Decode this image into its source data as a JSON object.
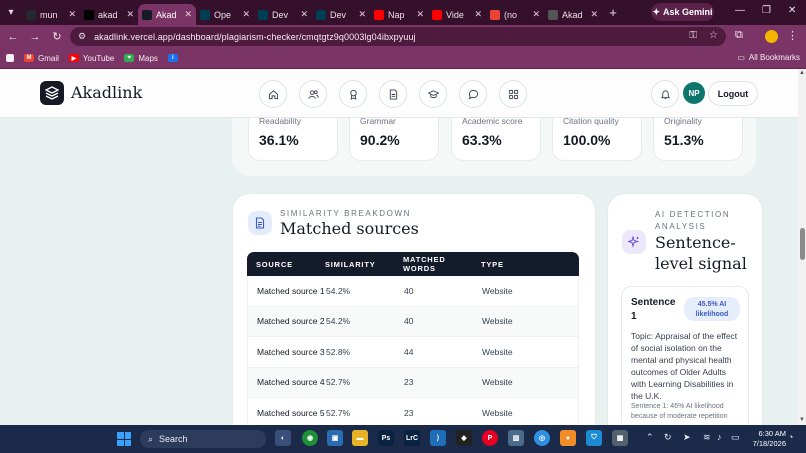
{
  "browser": {
    "tabs": [
      {
        "title": "mun",
        "active": false,
        "favicon": "github-icon",
        "color": "#24292f"
      },
      {
        "title": "akad",
        "active": false,
        "favicon": "vercel-icon",
        "color": "#000000"
      },
      {
        "title": "Akad",
        "active": true,
        "favicon": "akadlink-icon",
        "color": "#151a25"
      },
      {
        "title": "Ope",
        "active": false,
        "favicon": "devpost-icon",
        "color": "#003e54"
      },
      {
        "title": "Dev",
        "active": false,
        "favicon": "devpost-icon",
        "color": "#003e54"
      },
      {
        "title": "Dev",
        "active": false,
        "favicon": "devpost-icon",
        "color": "#003e54"
      },
      {
        "title": "Nap",
        "active": false,
        "favicon": "youtube-icon",
        "color": "#ff0000"
      },
      {
        "title": "Vide",
        "active": false,
        "favicon": "youtube-icon",
        "color": "#ff0000"
      },
      {
        "title": "(no",
        "active": false,
        "favicon": "gmail-icon",
        "color": "#ea4335"
      },
      {
        "title": "Akad",
        "active": false,
        "favicon": "akadlink-icon",
        "color": "#555555"
      }
    ],
    "gemini_label": "Ask Gemini",
    "url": "akadlink.vercel.app/dashboard/plagiarism-checker/cmqtgtz9q0003lg04ibxpyuuj",
    "bookmarks": [
      {
        "label": "Gmail",
        "icon": "gmail-icon",
        "color": "#ea4335"
      },
      {
        "label": "YouTube",
        "icon": "youtube-icon",
        "color": "#ff0000"
      },
      {
        "label": "Maps",
        "icon": "maps-icon",
        "color": "#34a853"
      }
    ],
    "all_bookmarks_label": "All Bookmarks"
  },
  "app": {
    "brand": "Akadlink",
    "user_initials": "NP",
    "logout_label": "Logout",
    "accent": "#0f766e"
  },
  "metrics": [
    {
      "label": "Readability",
      "value": "36.1%"
    },
    {
      "label": "Grammar",
      "value": "90.2%"
    },
    {
      "label": "Academic score",
      "value": "63.3%"
    },
    {
      "label": "Citation quality",
      "value": "100.0%"
    },
    {
      "label": "Originality",
      "value": "51.3%"
    }
  ],
  "similarity": {
    "eyebrow": "SIMILARITY BREAKDOWN",
    "title": "Matched sources",
    "columns": [
      "SOURCE",
      "SIMILARITY",
      "MATCHED WORDS",
      "TYPE"
    ],
    "rows": [
      {
        "source": "Matched source 1",
        "similarity": "54.2%",
        "words": "40",
        "type": "Website"
      },
      {
        "source": "Matched source 2",
        "similarity": "54.2%",
        "words": "40",
        "type": "Website"
      },
      {
        "source": "Matched source 3",
        "similarity": "52.8%",
        "words": "44",
        "type": "Website"
      },
      {
        "source": "Matched source 4",
        "similarity": "52.7%",
        "words": "23",
        "type": "Website"
      },
      {
        "source": "Matched source 5",
        "similarity": "52.7%",
        "words": "23",
        "type": "Website"
      }
    ]
  },
  "ai_detection": {
    "eyebrow": "AI DETECTION ANALYSIS",
    "title": "Sentence-level signal",
    "sentence_label": "Sentence 1",
    "badge": "45.5% AI likelihood",
    "text": "Topic: Appraisal of the effect of social isolation on the mental and physical health outcomes of Older Adults with Learning Disabilities in the U.K.",
    "note": "Sentence 1: 46% AI likelihood because of moderate repetition"
  },
  "taskbar": {
    "search_label": "Search",
    "time": "6:30 AM",
    "date": "7/18/2026"
  }
}
